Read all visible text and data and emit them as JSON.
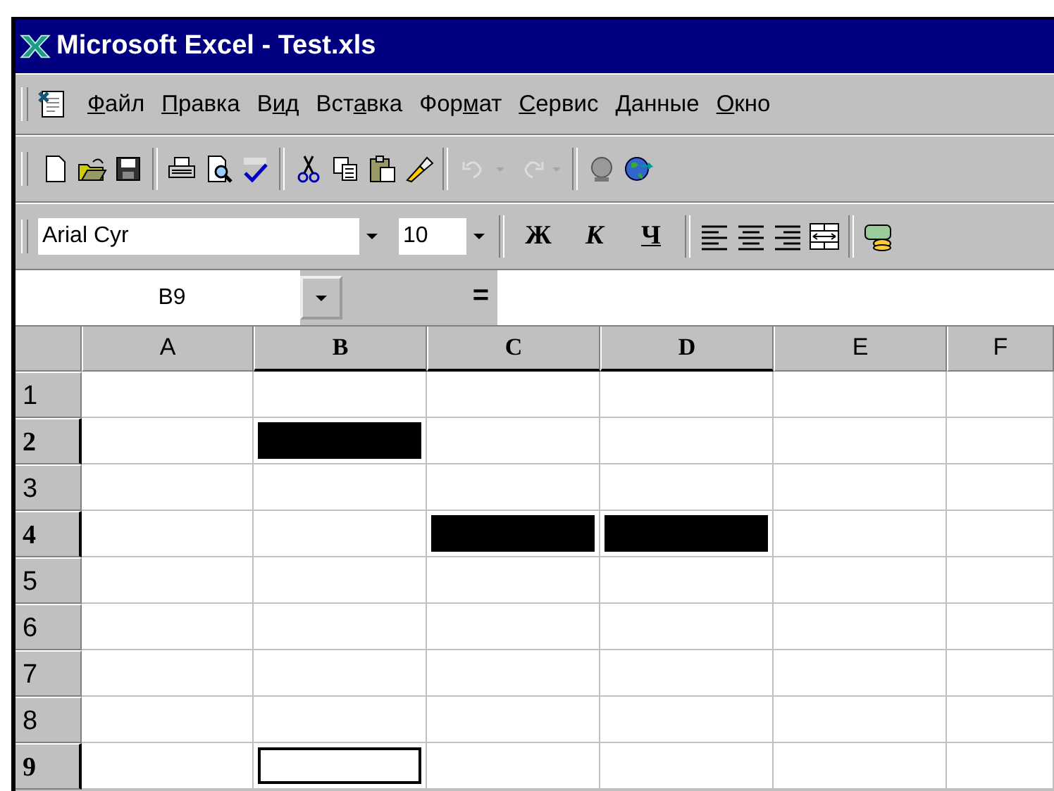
{
  "window": {
    "title": "Microsoft Excel - Test.xls"
  },
  "menu": [
    {
      "access_key": "Ф",
      "after": "айл"
    },
    {
      "access_key": "П",
      "after": "равка"
    },
    {
      "before": "В",
      "access_key": "и",
      "after": "д"
    },
    {
      "before": "Вст",
      "access_key": "а",
      "after": "вка"
    },
    {
      "before": "Фор",
      "access_key": "м",
      "after": "ат"
    },
    {
      "access_key": "С",
      "after": "ервис"
    },
    {
      "access_key": "Д",
      "after": "анные"
    },
    {
      "access_key": "О",
      "after": "кно"
    }
  ],
  "standard_toolbar": [
    [
      {
        "kind": "new",
        "disabled": false
      },
      {
        "kind": "open",
        "disabled": false
      },
      {
        "kind": "save",
        "disabled": false
      }
    ],
    [
      {
        "kind": "print",
        "disabled": false
      },
      {
        "kind": "preview",
        "disabled": false
      },
      {
        "kind": "spelling",
        "disabled": false
      }
    ],
    [
      {
        "kind": "cut",
        "disabled": false
      },
      {
        "kind": "copy",
        "disabled": false
      },
      {
        "kind": "paste",
        "disabled": false
      },
      {
        "kind": "painter",
        "disabled": false
      }
    ],
    [
      {
        "kind": "undo",
        "disabled": true
      },
      {
        "kind": "redo",
        "disabled": true
      }
    ],
    [
      {
        "kind": "link",
        "disabled": false
      },
      {
        "kind": "web",
        "disabled": false
      }
    ]
  ],
  "format_toolbar": {
    "font": "Arial Cyr",
    "size": "10",
    "styles": [
      "Ж",
      "К",
      "Ч"
    ],
    "tools": [
      {
        "kind": "align-left"
      },
      {
        "kind": "align-center"
      },
      {
        "kind": "align-right"
      },
      {
        "kind": "merge"
      },
      {
        "kind": "separator"
      },
      {
        "kind": "currency"
      }
    ]
  },
  "formula_bar": {
    "name_box": "B9",
    "equals": "="
  },
  "columns": [
    {
      "label": "A",
      "highlighted": false
    },
    {
      "label": "B",
      "highlighted": true
    },
    {
      "label": "C",
      "highlighted": true
    },
    {
      "label": "D",
      "highlighted": true
    },
    {
      "label": "E",
      "highlighted": false
    },
    {
      "label": "F",
      "highlighted": false
    }
  ],
  "rows": [
    {
      "label": "1",
      "highlighted": false,
      "cells": [
        {
          "selected": false,
          "active": false
        },
        {
          "selected": false,
          "active": false
        },
        {
          "selected": false,
          "active": false
        },
        {
          "selected": false,
          "active": false
        },
        {
          "selected": false,
          "active": false
        },
        {
          "selected": false,
          "active": false
        }
      ]
    },
    {
      "label": "2",
      "highlighted": true,
      "cells": [
        {
          "selected": false,
          "active": false
        },
        {
          "selected": true,
          "active": false
        },
        {
          "selected": false,
          "active": false
        },
        {
          "selected": false,
          "active": false
        },
        {
          "selected": false,
          "active": false
        },
        {
          "selected": false,
          "active": false
        }
      ]
    },
    {
      "label": "3",
      "highlighted": false,
      "cells": [
        {
          "selected": false,
          "active": false
        },
        {
          "selected": false,
          "active": false
        },
        {
          "selected": false,
          "active": false
        },
        {
          "selected": false,
          "active": false
        },
        {
          "selected": false,
          "active": false
        },
        {
          "selected": false,
          "active": false
        }
      ]
    },
    {
      "label": "4",
      "highlighted": true,
      "cells": [
        {
          "selected": false,
          "active": false
        },
        {
          "selected": false,
          "active": false
        },
        {
          "selected": true,
          "active": false
        },
        {
          "selected": true,
          "active": false
        },
        {
          "selected": false,
          "active": false
        },
        {
          "selected": false,
          "active": false
        }
      ]
    },
    {
      "label": "5",
      "highlighted": false,
      "cells": [
        {
          "selected": false,
          "active": false
        },
        {
          "selected": false,
          "active": false
        },
        {
          "selected": false,
          "active": false
        },
        {
          "selected": false,
          "active": false
        },
        {
          "selected": false,
          "active": false
        },
        {
          "selected": false,
          "active": false
        }
      ]
    },
    {
      "label": "6",
      "highlighted": false,
      "cells": [
        {
          "selected": false,
          "active": false
        },
        {
          "selected": false,
          "active": false
        },
        {
          "selected": false,
          "active": false
        },
        {
          "selected": false,
          "active": false
        },
        {
          "selected": false,
          "active": false
        },
        {
          "selected": false,
          "active": false
        }
      ]
    },
    {
      "label": "7",
      "highlighted": false,
      "cells": [
        {
          "selected": false,
          "active": false
        },
        {
          "selected": false,
          "active": false
        },
        {
          "selected": false,
          "active": false
        },
        {
          "selected": false,
          "active": false
        },
        {
          "selected": false,
          "active": false
        },
        {
          "selected": false,
          "active": false
        }
      ]
    },
    {
      "label": "8",
      "highlighted": false,
      "cells": [
        {
          "selected": false,
          "active": false
        },
        {
          "selected": false,
          "active": false
        },
        {
          "selected": false,
          "active": false
        },
        {
          "selected": false,
          "active": false
        },
        {
          "selected": false,
          "active": false
        },
        {
          "selected": false,
          "active": false
        }
      ]
    },
    {
      "label": "9",
      "highlighted": true,
      "cells": [
        {
          "selected": false,
          "active": false
        },
        {
          "selected": false,
          "active": true
        },
        {
          "selected": false,
          "active": false
        },
        {
          "selected": false,
          "active": false
        },
        {
          "selected": false,
          "active": false
        },
        {
          "selected": false,
          "active": false
        }
      ]
    }
  ]
}
